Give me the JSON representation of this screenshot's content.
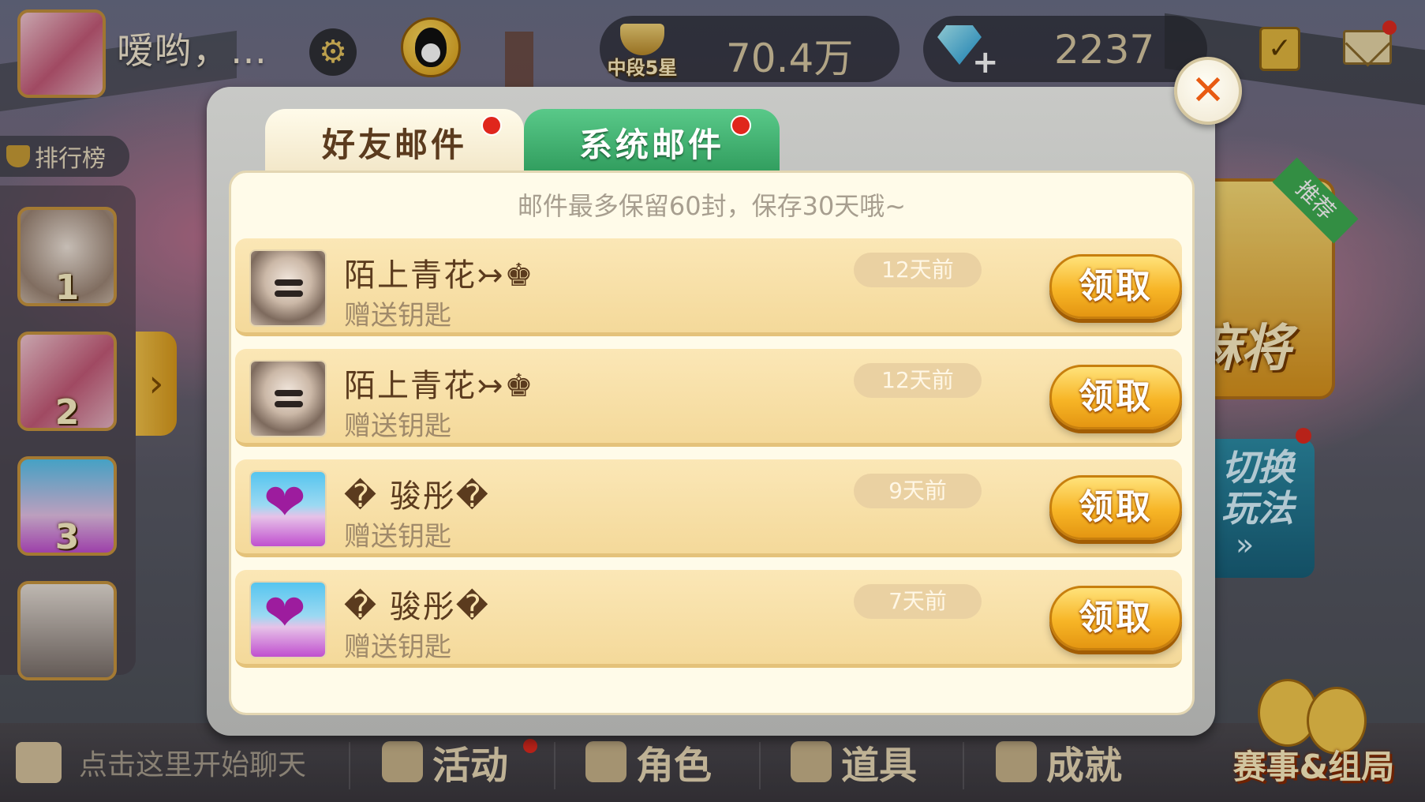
{
  "header": {
    "nickname": "嗳哟，…",
    "rank_label": "中段5星",
    "coins": "70.4万",
    "gems": "2237"
  },
  "sidebar": {
    "leaderboard_label": "排行榜",
    "ranks": [
      "1",
      "2",
      "3"
    ]
  },
  "promos": {
    "mahjong_tag": "推荐",
    "mahjong_label": "麻将",
    "switch_label": "切换玩法",
    "switch_arrow": "»"
  },
  "dialog": {
    "tabs": [
      {
        "label": "好友邮件",
        "active": true,
        "has_dot": true
      },
      {
        "label": "系统邮件",
        "active": false,
        "has_dot": true
      }
    ],
    "notice": "邮件最多保留60封，保存30天哦~",
    "close_icon": "close-x",
    "mails": [
      {
        "sender": "陌上青花↣♚",
        "desc": "赠送钥匙",
        "time": "12天前",
        "action": "领取",
        "avatar": "cat"
      },
      {
        "sender": "陌上青花↣♚",
        "desc": "赠送钥匙",
        "time": "12天前",
        "action": "领取",
        "avatar": "cat"
      },
      {
        "sender": "� 骏彤�",
        "desc": "赠送钥匙",
        "time": "9天前",
        "action": "领取",
        "avatar": "heart-tree"
      },
      {
        "sender": "� 骏彤�",
        "desc": "赠送钥匙",
        "time": "7天前",
        "action": "领取",
        "avatar": "heart-tree"
      }
    ]
  },
  "bottombar": {
    "chat_placeholder": "点击这里开始聊天",
    "nav": [
      "活动",
      "角色",
      "道具",
      "成就"
    ],
    "contest_label": "赛事&组局"
  },
  "colors": {
    "tab_active_bg": "#fffbea",
    "tab_inactive_bg": "#2f9b5c",
    "claim_button": "#f7b526",
    "row_bg": "#f4d99a",
    "notification_dot": "#e0261c"
  }
}
